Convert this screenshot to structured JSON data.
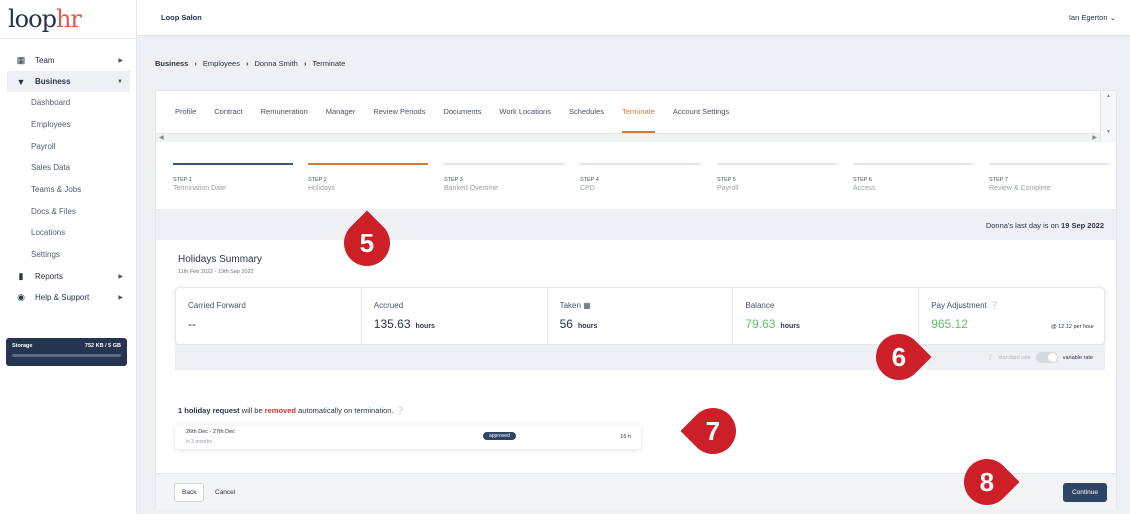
{
  "app": {
    "logo_text_a": "loop",
    "logo_text_b": "hr",
    "company": "Loop Salon",
    "user": "Ian Egerton",
    "user_chevron": "chevron-down-icon"
  },
  "sidebar": {
    "items": [
      {
        "label": "Team",
        "icon": "team-icon"
      },
      {
        "label": "Business",
        "icon": "business-icon"
      },
      {
        "label": "Reports",
        "icon": "reports-icon"
      },
      {
        "label": "Help & Support",
        "icon": "globe-icon"
      }
    ],
    "sub_items": [
      "Dashboard",
      "Employees",
      "Payroll",
      "Sales Data",
      "Teams & Jobs",
      "Docs & Files",
      "Locations",
      "Settings"
    ],
    "storage": {
      "label": "Storage",
      "value": "752 KB / 5 GB",
      "used_fraction": 0.0
    }
  },
  "breadcrumb": [
    "Business",
    "Employees",
    "Donna Smith",
    "Terminate"
  ],
  "tabs": [
    "Profile",
    "Contract",
    "Remuneration",
    "Manager",
    "Review Periods",
    "Documents",
    "Work Locations",
    "Schedules",
    "Terminate",
    "Account Settings"
  ],
  "active_tab": "Terminate",
  "steps": [
    {
      "num": "STEP 1",
      "name": "Termination Date",
      "state": "done"
    },
    {
      "num": "STEP 2",
      "name": "Holidays",
      "state": "current"
    },
    {
      "num": "STEP 3",
      "name": "Banked Overtime",
      "state": "todo"
    },
    {
      "num": "STEP 4",
      "name": "CPD",
      "state": "todo"
    },
    {
      "num": "STEP 5",
      "name": "Payroll",
      "state": "todo"
    },
    {
      "num": "STEP 6",
      "name": "Access",
      "state": "todo"
    },
    {
      "num": "STEP 7",
      "name": "Review & Complete",
      "state": "todo"
    }
  ],
  "last_day": {
    "prefix": "Donna's last day is on",
    "date": "19 Sep 2022"
  },
  "summary": {
    "title": "Holidays Summary",
    "range": "11th Feb 2022 - 19th Sep 2022",
    "stats": [
      {
        "label": "Carried Forward",
        "value": "--",
        "unit": ""
      },
      {
        "label": "Accrued",
        "value": "135.63",
        "unit": "hours"
      },
      {
        "label": "Taken",
        "value": "56",
        "unit": "hours"
      },
      {
        "label": "Balance",
        "value": "79.63",
        "unit": "hours"
      },
      {
        "label": "Pay Adjustment",
        "value": "965.12",
        "unit": ""
      }
    ],
    "rate": "@ 12.12 per hour",
    "rate_off": "standard rate",
    "rate_on": "variable rate"
  },
  "holiday_note": {
    "count": "1 holiday request",
    "middle": "will be",
    "removed": "removed",
    "suffix": "automatically on termination."
  },
  "request": {
    "dates": "26th Dec - 27th Dec",
    "when": "in 3 months",
    "status": "approved",
    "hours": "16 h"
  },
  "footer": {
    "back": "Back",
    "cancel": "Cancel",
    "continue": "Continue"
  },
  "markers": [
    "5",
    "6",
    "7",
    "8"
  ],
  "colors": {
    "accent": "#d77a38",
    "navy": "#2f4565",
    "marker": "#cc1f27",
    "green": "#5fbf6a",
    "removed": "#d9332f"
  }
}
